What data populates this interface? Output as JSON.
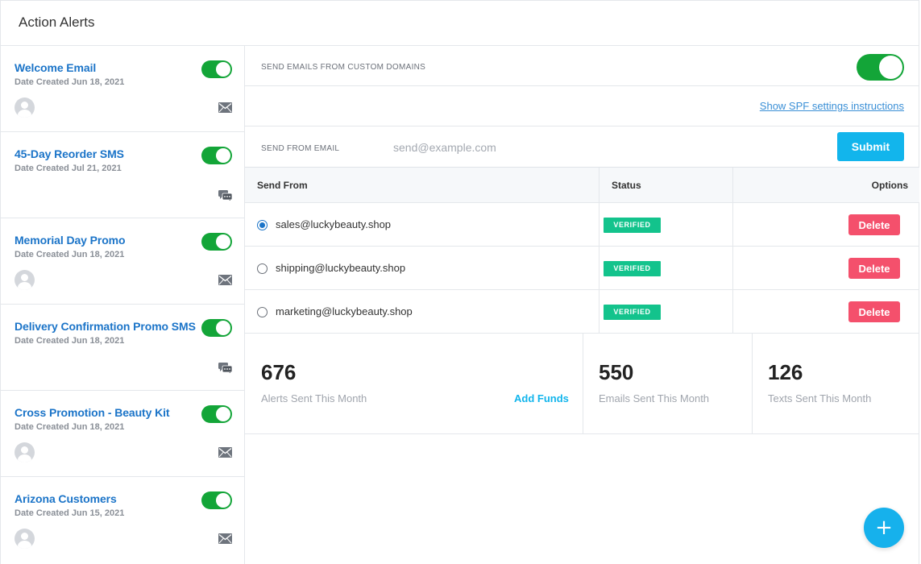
{
  "header": {
    "title": "Action Alerts"
  },
  "sidebar": {
    "items": [
      {
        "name": "Welcome Email",
        "date": "Date Created Jun 18, 2021",
        "type": "email",
        "enabled": true
      },
      {
        "name": "45-Day Reorder SMS",
        "date": "Date Created Jul 21, 2021",
        "type": "sms",
        "enabled": true
      },
      {
        "name": "Memorial Day Promo",
        "date": "Date Created Jun 18, 2021",
        "type": "email",
        "enabled": true
      },
      {
        "name": "Delivery Confirmation Promo SMS",
        "date": "Date Created Jun 18, 2021",
        "type": "sms",
        "enabled": true
      },
      {
        "name": "Cross Promotion - Beauty Kit",
        "date": "Date Created Jun 18, 2021",
        "type": "email",
        "enabled": true
      },
      {
        "name": "Arizona Customers",
        "date": "Date Created Jun 15, 2021",
        "type": "email",
        "enabled": true
      }
    ]
  },
  "settings": {
    "custom_domains_label": "SEND EMAILS FROM CUSTOM DOMAINS",
    "custom_domains_enabled": true,
    "spf_link": "Show SPF settings instructions",
    "send_from_label": "SEND FROM EMAIL",
    "send_from_value": "",
    "send_from_placeholder": "send@example.com",
    "submit_label": "Submit"
  },
  "table": {
    "columns": [
      "Send From",
      "Status",
      "Options"
    ],
    "rows": [
      {
        "email": "sales@luckybeauty.shop",
        "status": "VERIFIED",
        "selected": true,
        "action": "Delete"
      },
      {
        "email": "shipping@luckybeauty.shop",
        "status": "VERIFIED",
        "selected": false,
        "action": "Delete"
      },
      {
        "email": "marketing@luckybeauty.shop",
        "status": "VERIFIED",
        "selected": false,
        "action": "Delete"
      }
    ]
  },
  "stats": {
    "alerts": {
      "value": "676",
      "label": "Alerts Sent This Month"
    },
    "add_funds": "Add Funds",
    "emails": {
      "value": "550",
      "label": "Emails Sent This Month"
    },
    "texts": {
      "value": "126",
      "label": "Texts Sent This Month"
    }
  },
  "fab": {
    "label": "+"
  },
  "colors": {
    "accent": "#12b5ec",
    "link": "#1b74c8",
    "toggle_on": "#13a538",
    "verified": "#13c38c",
    "delete": "#f4506c"
  },
  "icons": {
    "email": "envelope-icon",
    "sms": "chat-bubbles-icon",
    "avatar": "user-avatar-icon",
    "fab": "plus-icon"
  }
}
